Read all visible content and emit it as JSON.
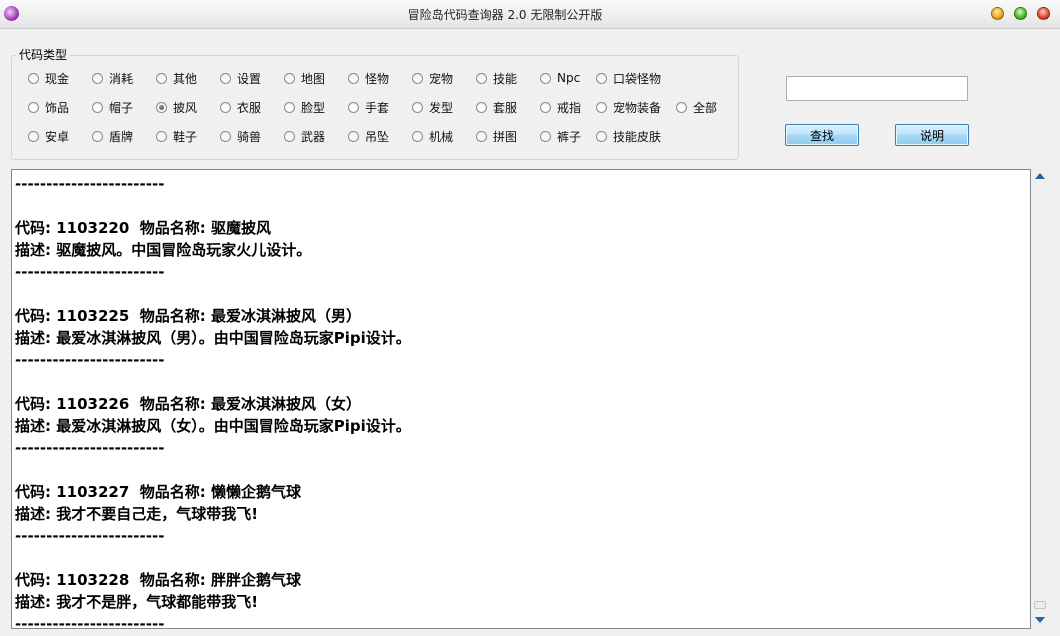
{
  "window": {
    "title": "冒险岛代码查询器 2.0 无限制公开版"
  },
  "code_type_group": {
    "legend": "代码类型",
    "rows": [
      [
        "现金",
        "消耗",
        "其他",
        "设置",
        "地图",
        "怪物",
        "宠物",
        "技能",
        "Npc",
        "口袋怪物"
      ],
      [
        "饰品",
        "帽子",
        "披风",
        "衣服",
        "脸型",
        "手套",
        "发型",
        "套服",
        "戒指",
        "宠物装备",
        "全部"
      ],
      [
        "安卓",
        "盾牌",
        "鞋子",
        "骑兽",
        "武器",
        "吊坠",
        "机械",
        "拼图",
        "裤子",
        "技能皮肤"
      ]
    ],
    "selected": "披风"
  },
  "search": {
    "value": "",
    "placeholder": ""
  },
  "buttons": {
    "find_label": "查找",
    "help_label": "说明"
  },
  "results": {
    "lines": [
      "------------------------",
      "",
      "代码: 1103220  物品名称: 驱魔披风",
      "描述: 驱魔披风。中国冒险岛玩家火儿设计。",
      "------------------------",
      "",
      "代码: 1103225  物品名称: 最爱冰淇淋披风（男）",
      "描述: 最爱冰淇淋披风（男）。由中国冒险岛玩家Pipi设计。",
      "------------------------",
      "",
      "代码: 1103226  物品名称: 最爱冰淇淋披风（女）",
      "描述: 最爱冰淇淋披风（女）。由中国冒险岛玩家Pipi设计。",
      "------------------------",
      "",
      "代码: 1103227  物品名称: 懒懒企鹅气球",
      "描述: 我才不要自己走，气球带我飞!",
      "------------------------",
      "",
      "代码: 1103228  物品名称: 胖胖企鹅气球",
      "描述: 我才不是胖，气球都能带我飞!",
      "------------------------"
    ]
  },
  "icons": {
    "app": "maple-app-icon",
    "minimize": "minimize-icon",
    "maximize": "maximize-icon",
    "close": "close-icon",
    "scroll_up": "scroll-up-arrow-icon",
    "scroll_down": "scroll-down-arrow-icon"
  },
  "colors": {
    "button_bg": "#bee6fd",
    "button_border": "#3c7fb1",
    "window_bg": "#f0f0f0"
  }
}
